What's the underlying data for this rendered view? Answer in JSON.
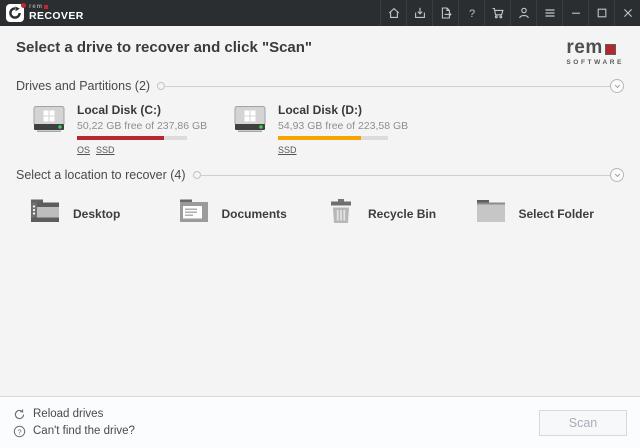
{
  "titlebar": {
    "brand_name": "rem",
    "brand_product": "RECOVER",
    "icons": [
      "home",
      "save-session",
      "open-file",
      "help",
      "cart",
      "account",
      "menu",
      "minimize",
      "maximize",
      "close"
    ]
  },
  "header": {
    "title": "Select a drive to recover and click \"Scan\"",
    "logo_word": "rem",
    "logo_sub": "SOFTWARE"
  },
  "drives_section": {
    "label": "Drives and Partitions (2)"
  },
  "locations_section": {
    "label": "Select a location to recover (4)"
  },
  "drives": [
    {
      "name": "Local Disk (C:)",
      "capacity": "50,22 GB free of 237,86 GB",
      "used_percent": 79,
      "bar_color": "#b5292e",
      "tag1": "OS",
      "tag2": "SSD"
    },
    {
      "name": "Local Disk (D:)",
      "capacity": "54,93 GB free of 223,58 GB",
      "used_percent": 75,
      "bar_color": "#f8a400",
      "tag1": "SSD",
      "tag2": ""
    }
  ],
  "locations": [
    {
      "label": "Desktop"
    },
    {
      "label": "Documents"
    },
    {
      "label": "Recycle Bin"
    },
    {
      "label": "Select Folder"
    }
  ],
  "footer": {
    "reload_label": "Reload drives",
    "help_label": "Can't find the drive?",
    "scan_label": "Scan"
  },
  "colors": {
    "titlebar_bg": "#2b2e30",
    "accent_red": "#b5292e",
    "accent_orange": "#f8a400",
    "bar_track": "#dcdcdc"
  }
}
